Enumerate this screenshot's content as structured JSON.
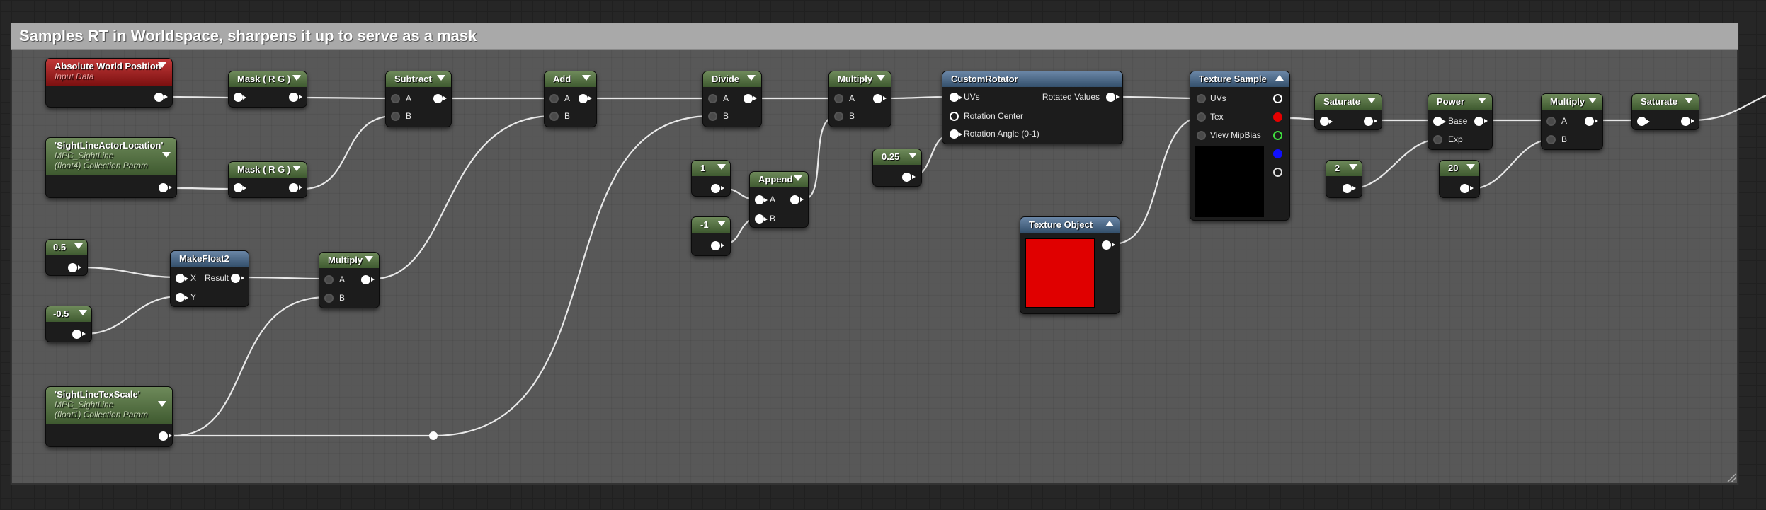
{
  "comment": {
    "title": "Samples RT in Worldspace, sharpens it up to serve as a mask"
  },
  "nodes": {
    "absolute_world_position": {
      "title": "Absolute World Position",
      "subtitle": "Input Data"
    },
    "mask_rg_1": {
      "title": "Mask ( R G )"
    },
    "mask_rg_2": {
      "title": "Mask ( R G )"
    },
    "sight_line_actor_location": {
      "title": "'SightLineActorLocation'",
      "subtitle1": "MPC_SightLine",
      "subtitle2": "(float4) Collection Param"
    },
    "subtract": {
      "title": "Subtract",
      "pin_a": "A",
      "pin_b": "B"
    },
    "add": {
      "title": "Add",
      "pin_a": "A",
      "pin_b": "B"
    },
    "divide": {
      "title": "Divide",
      "pin_a": "A",
      "pin_b": "B"
    },
    "multiply_1": {
      "title": "Multiply",
      "pin_a": "A",
      "pin_b": "B"
    },
    "const_half": {
      "value": "0.5"
    },
    "const_neg_half": {
      "value": "-0.5"
    },
    "make_float2": {
      "title": "MakeFloat2",
      "pin_x": "X",
      "pin_y": "Y",
      "pin_result": "Result"
    },
    "multiply_2": {
      "title": "Multiply",
      "pin_a": "A",
      "pin_b": "B"
    },
    "sight_line_tex_scale": {
      "title": "'SightLineTexScale'",
      "subtitle1": "MPC_SightLine",
      "subtitle2": "(float1) Collection Param"
    },
    "const_one": {
      "value": "1"
    },
    "const_neg_one": {
      "value": "-1"
    },
    "append": {
      "title": "Append",
      "pin_a": "A",
      "pin_b": "B"
    },
    "const_quarter": {
      "value": "0.25"
    },
    "custom_rotator": {
      "title": "CustomRotator",
      "pin_uvs": "UVs",
      "pin_center": "Rotation Center",
      "pin_angle": "Rotation Angle (0-1)",
      "pin_out": "Rotated Values"
    },
    "texture_object": {
      "title": "Texture Object",
      "swatch_color": "#e00000"
    },
    "texture_sample": {
      "title": "Texture Sample",
      "pin_uvs": "UVs",
      "pin_tex": "Tex",
      "pin_mip": "View MipBias",
      "preview_color": "#000000"
    },
    "saturate_1": {
      "title": "Saturate"
    },
    "power": {
      "title": "Power",
      "pin_base": "Base",
      "pin_exp": "Exp"
    },
    "const_two": {
      "value": "2"
    },
    "const_twenty": {
      "value": "20"
    },
    "multiply_3": {
      "title": "Multiply",
      "pin_a": "A",
      "pin_b": "B"
    },
    "saturate_2": {
      "title": "Saturate"
    }
  },
  "icons": {
    "collapse_arrow": "chevron-down-icon",
    "expand_arrow": "chevron-up-icon",
    "pin": "pin-circle-icon"
  },
  "colors": {
    "header_green": "#4f6b3e",
    "header_blue": "#3e5b79",
    "header_red": "#9b1c1c",
    "comment_header": "#a9a9a9",
    "wire": "#e8e8e8",
    "pin_r": "#e60000",
    "pin_g": "#40e040",
    "pin_b": "#1010ff"
  }
}
